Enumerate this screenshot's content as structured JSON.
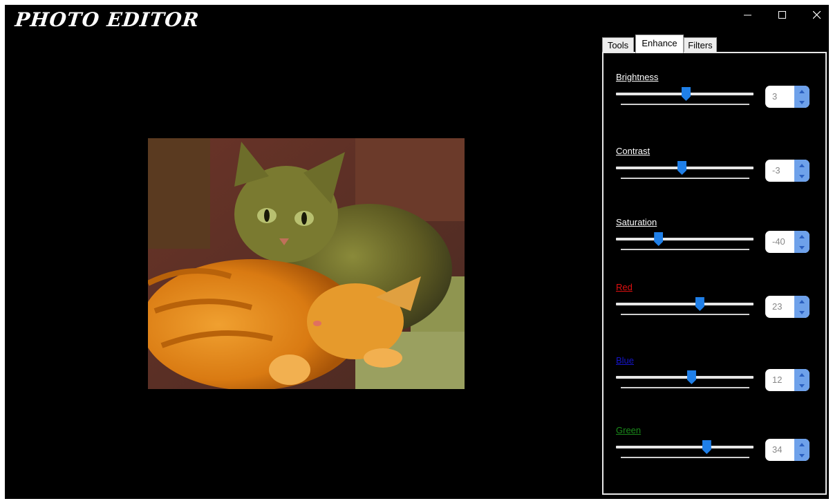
{
  "app": {
    "title": "PHOTO EDITOR"
  },
  "window_controls": {
    "minimize_icon": "minimize-icon",
    "maximize_icon": "maximize-icon",
    "close_icon": "close-icon"
  },
  "tabs": [
    {
      "label": "Tools",
      "active": false
    },
    {
      "label": "Enhance",
      "active": true
    },
    {
      "label": "Filters",
      "active": false
    }
  ],
  "enhance": {
    "controls": [
      {
        "label": "Brightness",
        "value": "3",
        "slider_fraction": 0.51,
        "label_color": "#ffffff"
      },
      {
        "label": "Contrast",
        "value": "-3",
        "slider_fraction": 0.48,
        "label_color": "#ffffff"
      },
      {
        "label": "Saturation",
        "value": "-40",
        "slider_fraction": 0.31,
        "label_color": "#ffffff"
      },
      {
        "label": "Red",
        "value": "23",
        "slider_fraction": 0.61,
        "label_color": "#e01010"
      },
      {
        "label": "Blue",
        "value": "12",
        "slider_fraction": 0.55,
        "label_color": "#1515c8"
      },
      {
        "label": "Green",
        "value": "34",
        "slider_fraction": 0.66,
        "label_color": "#1a8a1a"
      }
    ]
  },
  "colors": {
    "accent": "#1f7fe8",
    "spinner": "#6ea1ea",
    "background": "#000000"
  }
}
